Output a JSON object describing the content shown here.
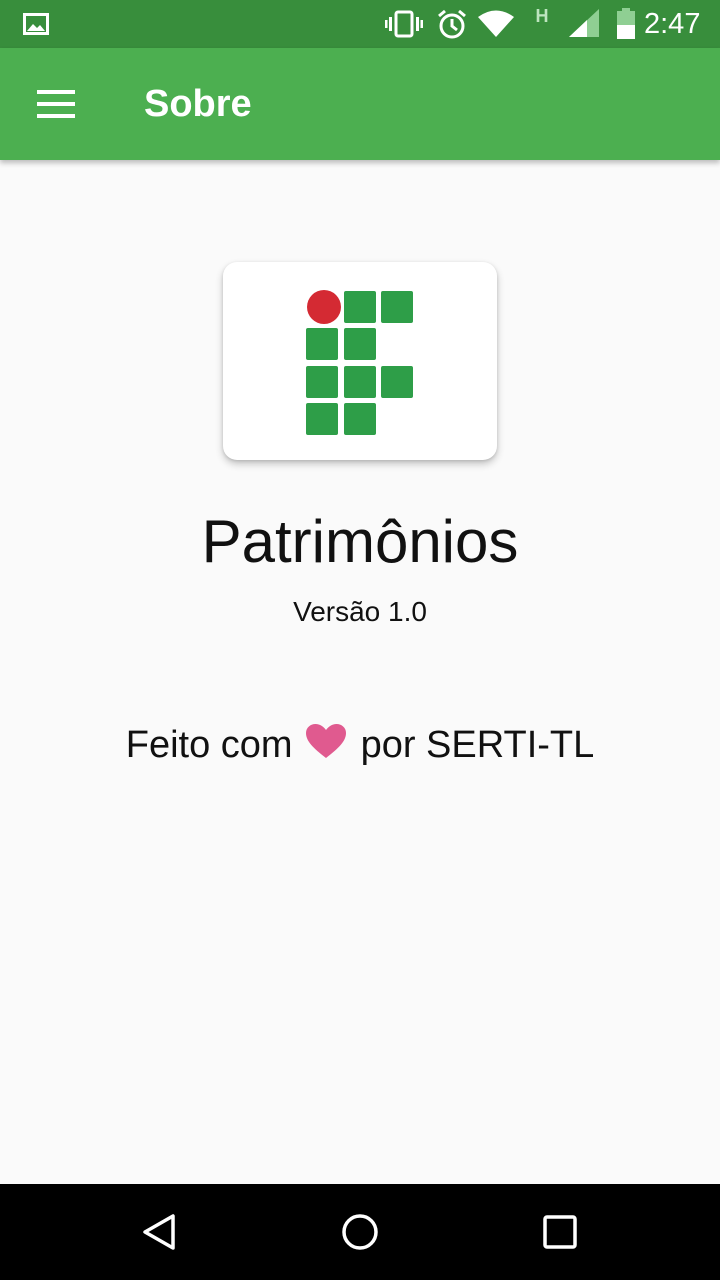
{
  "status_bar": {
    "time": "2:47",
    "network_type": "H",
    "icons": [
      "image-icon",
      "vibrate-icon",
      "alarm-icon",
      "wifi-icon",
      "signal-icon",
      "battery-icon"
    ]
  },
  "app_bar": {
    "title": "Sobre",
    "menu_icon": "menu-icon"
  },
  "about": {
    "app_name": "Patrimônios",
    "version": "Versão 1.0",
    "credits_prefix": "Feito com",
    "credits_suffix": "por SERTI-TL",
    "heart_icon": "heart-icon"
  },
  "colors": {
    "status_bar": "#388e3c",
    "app_bar": "#4caf50",
    "logo_green": "#2e9e48",
    "logo_red": "#d42a33",
    "heart": "#e05a8f"
  },
  "nav_bar": {
    "icons": [
      "back-icon",
      "home-icon",
      "recents-icon"
    ]
  }
}
